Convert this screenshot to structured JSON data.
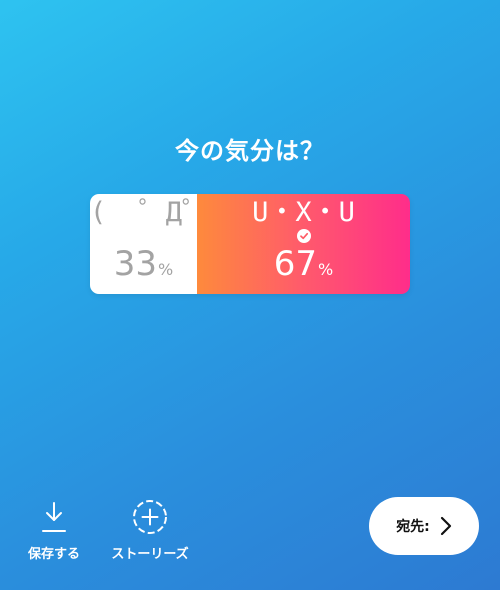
{
  "question": "今の気分は？",
  "poll": {
    "options": [
      {
        "text": "(  ゜Д゜)",
        "percent": "33",
        "unit": "%",
        "selected": false
      },
      {
        "text": "U・X・U",
        "percent": "67",
        "unit": "%",
        "selected": true
      }
    ],
    "colors": {
      "left_bg": "#ffffff",
      "left_text": "#a3a3a3",
      "right_gradient": [
        "#fe8a3c",
        "#ff2d8a"
      ]
    }
  },
  "actions": {
    "save_label": "保存する",
    "story_label": "ストーリーズ",
    "send_label": "宛先:",
    "save_icon": "download-icon",
    "story_icon": "add-story-icon",
    "send_icon": "chevron-right-icon"
  },
  "background_gradient": [
    "#2ec3f0",
    "#2d7ad2"
  ]
}
